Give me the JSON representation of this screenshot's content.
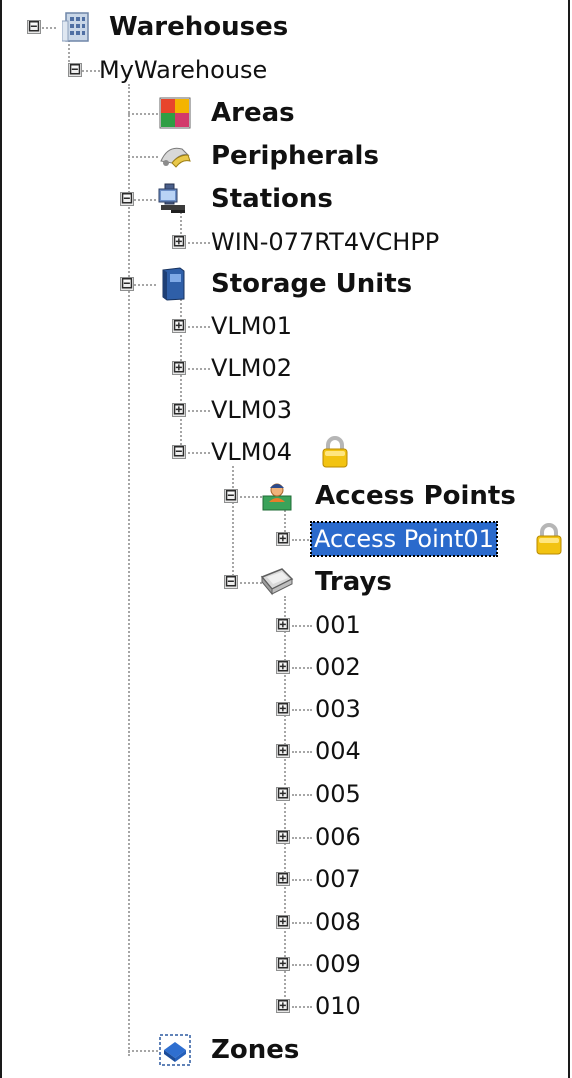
{
  "colors": {
    "selection": "#2a6acc",
    "tree_lines": "#a6a6a6",
    "lock": "#f2c311"
  },
  "tree": {
    "warehouses": {
      "label": "Warehouses",
      "expander": "⊟",
      "icon": "building-icon"
    },
    "my_warehouse": {
      "label": "MyWarehouse",
      "expander": "⊟"
    },
    "areas": {
      "label": "Areas",
      "icon": "areas-icon"
    },
    "peripherals": {
      "label": "Peripherals",
      "icon": "peripherals-icon"
    },
    "stations": {
      "label": "Stations",
      "expander": "⊟",
      "icon": "computer-icon",
      "children": [
        {
          "label": "WIN-077RT4VCHPP",
          "expander": "⊞"
        }
      ]
    },
    "storage_units": {
      "label": "Storage Units",
      "expander": "⊟",
      "icon": "storage-unit-icon",
      "children": [
        {
          "label": "VLM01",
          "expander": "⊞"
        },
        {
          "label": "VLM02",
          "expander": "⊞"
        },
        {
          "label": "VLM03",
          "expander": "⊞"
        },
        {
          "label": "VLM04",
          "expander": "⊟",
          "locked": true
        }
      ]
    },
    "access_points": {
      "label": "Access Points",
      "expander": "⊟",
      "icon": "access-point-icon",
      "children": [
        {
          "label": "Access Point01",
          "expander": "⊞",
          "selected": true,
          "locked": true
        }
      ]
    },
    "trays": {
      "label": "Trays",
      "expander": "⊟",
      "icon": "tray-icon",
      "children": [
        {
          "label": "001",
          "expander": "⊞"
        },
        {
          "label": "002",
          "expander": "⊞"
        },
        {
          "label": "003",
          "expander": "⊞"
        },
        {
          "label": "004",
          "expander": "⊞"
        },
        {
          "label": "005",
          "expander": "⊞"
        },
        {
          "label": "006",
          "expander": "⊞"
        },
        {
          "label": "007",
          "expander": "⊞"
        },
        {
          "label": "008",
          "expander": "⊞"
        },
        {
          "label": "009",
          "expander": "⊞"
        },
        {
          "label": "010",
          "expander": "⊞"
        }
      ]
    },
    "zones": {
      "label": "Zones",
      "icon": "zones-icon"
    }
  }
}
